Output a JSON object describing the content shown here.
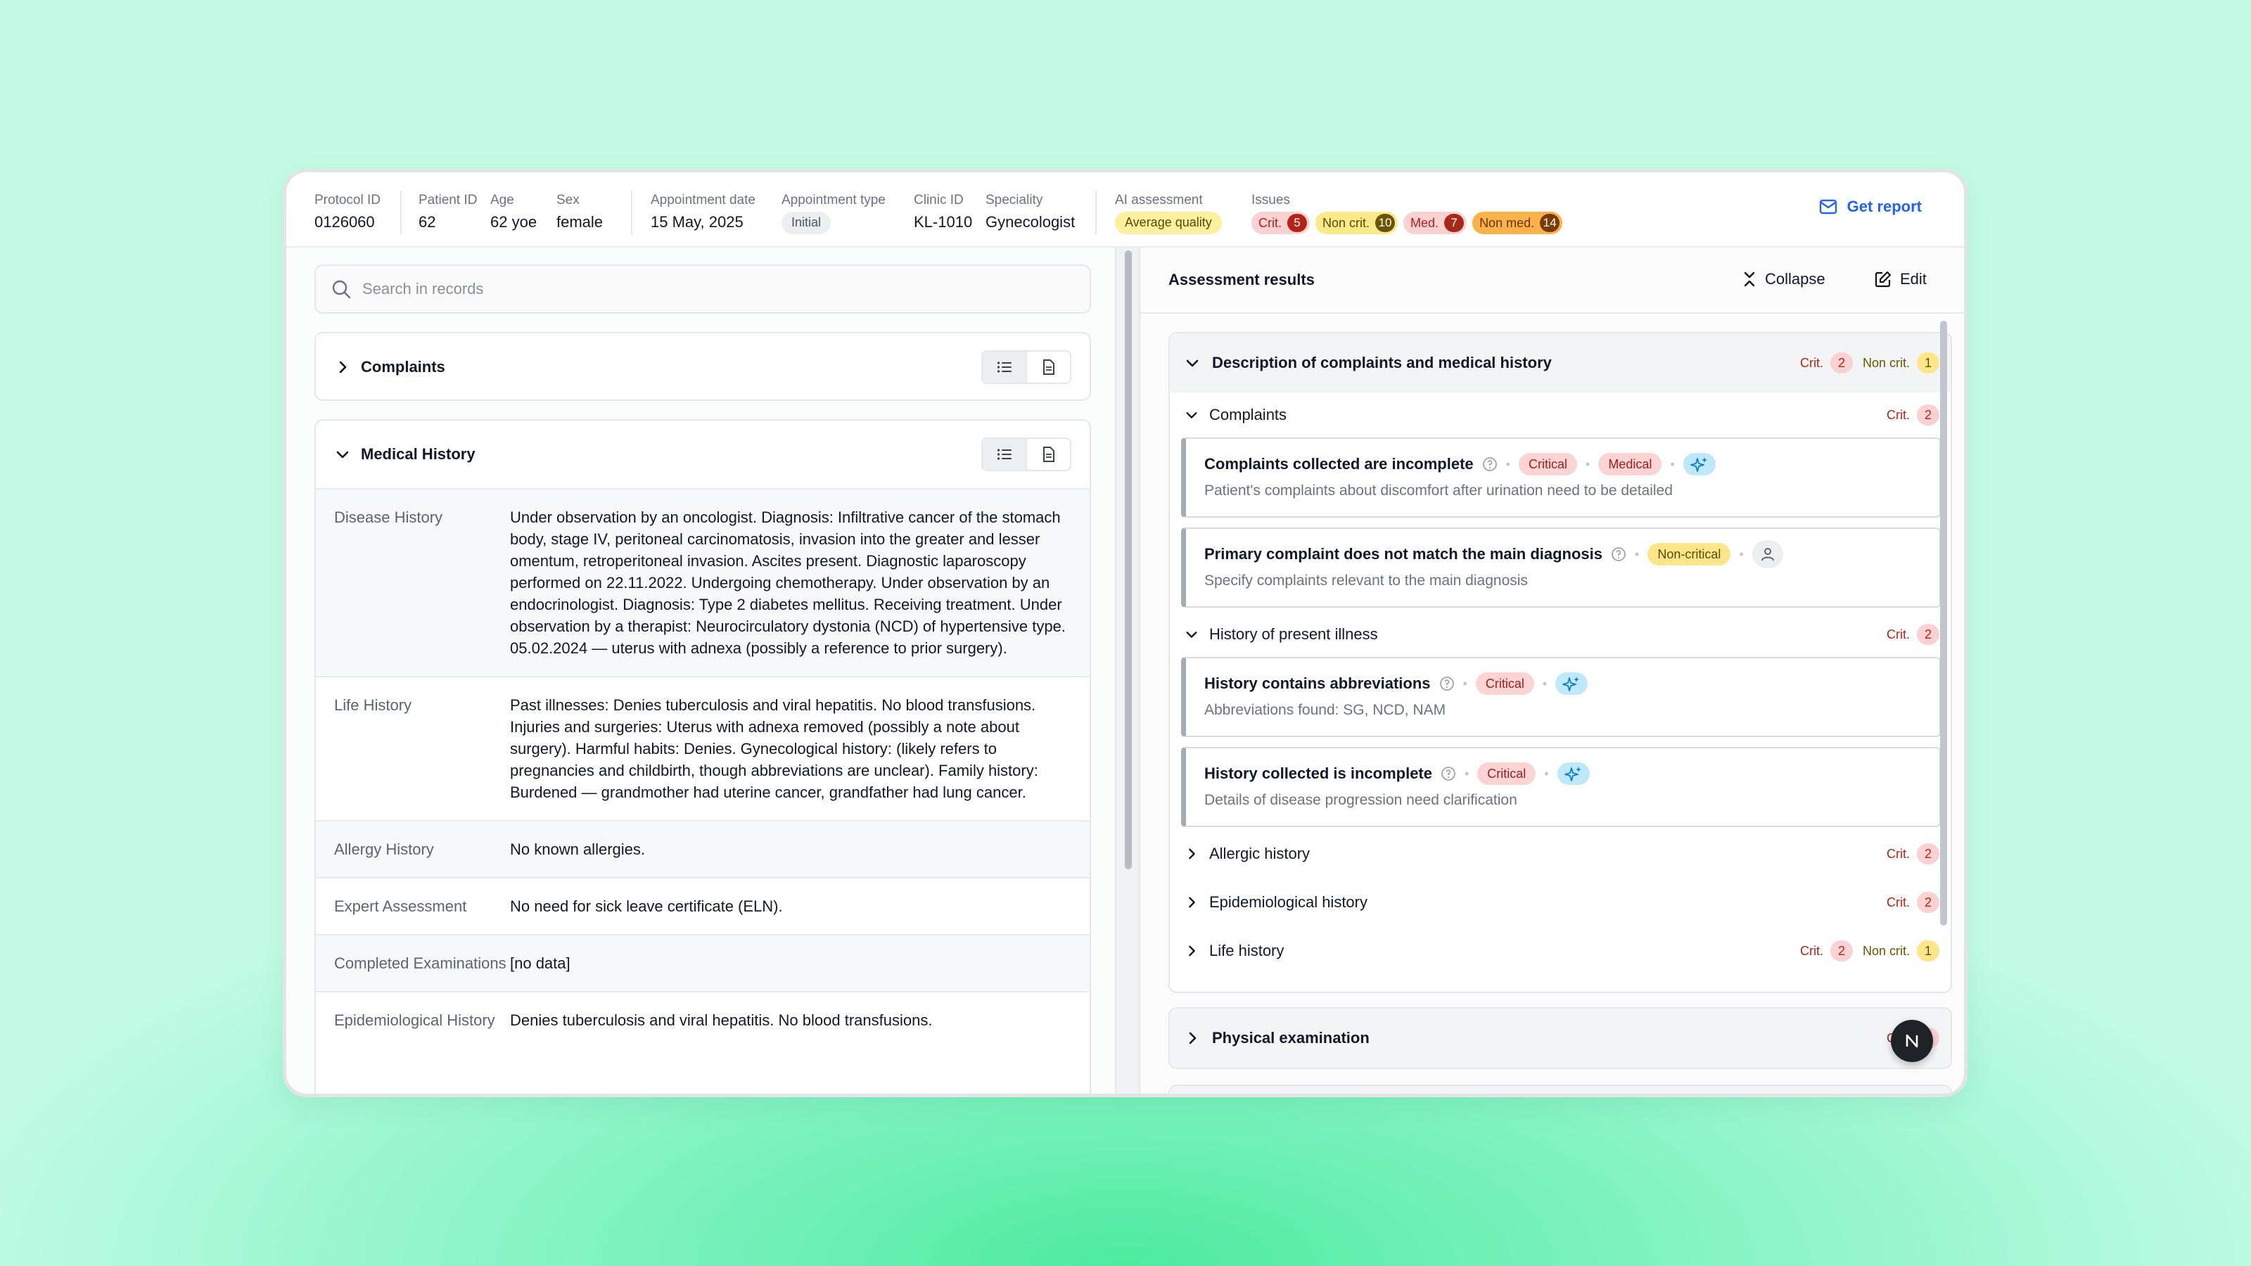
{
  "header": {
    "protocol_id": {
      "label": "Protocol ID",
      "value": "0126060"
    },
    "patient_id": {
      "label": "Patient ID",
      "value": "62"
    },
    "age": {
      "label": "Age",
      "value": "62 yoe"
    },
    "sex": {
      "label": "Sex",
      "value": "female"
    },
    "appointment_date": {
      "label": "Appointment date",
      "value": "15 May, 2025"
    },
    "appointment_type": {
      "label": "Appointment type",
      "value": "Initial"
    },
    "clinic_id": {
      "label": "Clinic ID",
      "value": "KL-1010"
    },
    "speciality": {
      "label": "Speciality",
      "value": "Gynecologist"
    },
    "ai_assessment": {
      "label": "AI assessment",
      "value": "Average quality"
    },
    "issues": {
      "label": "Issues",
      "crit": {
        "label": "Crit.",
        "count": "5"
      },
      "noncrit": {
        "label": "Non crit.",
        "count": "10"
      },
      "med": {
        "label": "Med.",
        "count": "7"
      },
      "nonmed": {
        "label": "Non med.",
        "count": "14"
      }
    },
    "get_report": "Get report",
    "colors": {
      "accent": "#2563eb",
      "critical": "#b42318",
      "noncritical": "#6b5400"
    }
  },
  "left": {
    "search_placeholder": "Search in records",
    "complaints_title": "Complaints",
    "medical_history_title": "Medical History",
    "rows": [
      {
        "key": "Disease History",
        "value": "Under observation by an oncologist. Diagnosis: Infiltrative cancer of the stomach body, stage IV, peritoneal carcinomatosis, invasion into the greater and lesser omentum, retroperitoneal invasion. Ascites present. Diagnostic laparoscopy performed on 22.11.2022. Undergoing chemotherapy. Under observation by an endocrinologist. Diagnosis: Type 2 diabetes mellitus. Receiving treatment. Under observation by a therapist: Neurocirculatory dystonia (NCD) of hypertensive type. 05.02.2024 — uterus with adnexa (possibly a reference to prior surgery)."
      },
      {
        "key": "Life History",
        "value": "Past illnesses: Denies tuberculosis and viral hepatitis. No blood transfusions. Injuries and surgeries: Uterus with adnexa removed (possibly a note about surgery). Harmful habits: Denies. Gynecological history: (likely refers to pregnancies and childbirth, though abbreviations are unclear). Family history: Burdened — grandmother had uterine cancer, grandfather had lung cancer."
      },
      {
        "key": "Allergy History",
        "value": "No known allergies."
      },
      {
        "key": "Expert Assessment",
        "value": "No need for sick leave certificate (ELN)."
      },
      {
        "key": "Completed Examinations",
        "value": "[no data]"
      },
      {
        "key": "Epidemiological History",
        "value": "Denies tuberculosis and viral hepatitis. No blood transfusions."
      }
    ]
  },
  "right": {
    "title": "Assessment results",
    "collapse": "Collapse",
    "edit": "Edit",
    "section1": {
      "title": "Description of complaints and medical history",
      "crit_label": "Crit.",
      "crit": "2",
      "noncrit_label": "Non crit.",
      "noncrit": "1"
    },
    "complaints": {
      "title": "Complaints",
      "crit_label": "Crit.",
      "crit": "2"
    },
    "issue1": {
      "title": "Complaints collected are incomplete",
      "tag1": "Critical",
      "tag2": "Medical",
      "desc": "Patient's complaints about discomfort after urination need to be detailed"
    },
    "issue2": {
      "title": "Primary complaint does not match the main diagnosis",
      "tag1": "Non-critical",
      "desc": "Specify complaints relevant to the main diagnosis"
    },
    "hpi": {
      "title": "History of present illness",
      "crit_label": "Crit.",
      "crit": "2"
    },
    "issue3": {
      "title": "History contains abbreviations",
      "tag1": "Critical",
      "desc": "Abbreviations found: SG, NCD, NAM"
    },
    "issue4": {
      "title": "History collected is incomplete",
      "tag1": "Critical",
      "desc": "Details of disease progression need clarification"
    },
    "allergic": {
      "title": "Allergic history",
      "crit_label": "Crit.",
      "crit": "2"
    },
    "epid": {
      "title": "Epidemiological history",
      "crit_label": "Crit.",
      "crit": "2"
    },
    "life": {
      "title": "Life history",
      "crit_label": "Crit.",
      "crit": "2",
      "noncrit_label": "Non crit.",
      "noncrit": "1"
    },
    "section2": {
      "title": "Physical examination",
      "crit_label": "Crit.",
      "crit": "2"
    },
    "fab_letter": "N"
  }
}
